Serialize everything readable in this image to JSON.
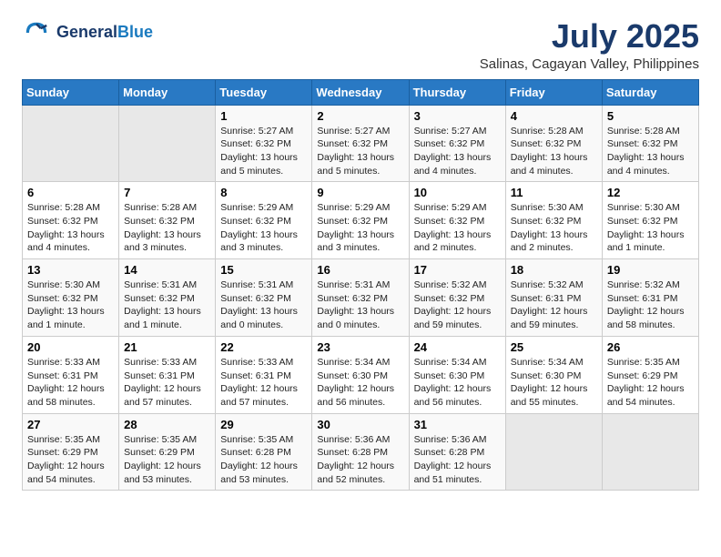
{
  "header": {
    "logo_line1": "General",
    "logo_line2": "Blue",
    "title": "July 2025",
    "subtitle": "Salinas, Cagayan Valley, Philippines"
  },
  "weekdays": [
    "Sunday",
    "Monday",
    "Tuesday",
    "Wednesday",
    "Thursday",
    "Friday",
    "Saturday"
  ],
  "weeks": [
    [
      {
        "day": "",
        "empty": true
      },
      {
        "day": "",
        "empty": true
      },
      {
        "day": "1",
        "sunrise": "5:27 AM",
        "sunset": "6:32 PM",
        "daylight": "13 hours and 5 minutes."
      },
      {
        "day": "2",
        "sunrise": "5:27 AM",
        "sunset": "6:32 PM",
        "daylight": "13 hours and 5 minutes."
      },
      {
        "day": "3",
        "sunrise": "5:27 AM",
        "sunset": "6:32 PM",
        "daylight": "13 hours and 4 minutes."
      },
      {
        "day": "4",
        "sunrise": "5:28 AM",
        "sunset": "6:32 PM",
        "daylight": "13 hours and 4 minutes."
      },
      {
        "day": "5",
        "sunrise": "5:28 AM",
        "sunset": "6:32 PM",
        "daylight": "13 hours and 4 minutes."
      }
    ],
    [
      {
        "day": "6",
        "sunrise": "5:28 AM",
        "sunset": "6:32 PM",
        "daylight": "13 hours and 4 minutes."
      },
      {
        "day": "7",
        "sunrise": "5:28 AM",
        "sunset": "6:32 PM",
        "daylight": "13 hours and 3 minutes."
      },
      {
        "day": "8",
        "sunrise": "5:29 AM",
        "sunset": "6:32 PM",
        "daylight": "13 hours and 3 minutes."
      },
      {
        "day": "9",
        "sunrise": "5:29 AM",
        "sunset": "6:32 PM",
        "daylight": "13 hours and 3 minutes."
      },
      {
        "day": "10",
        "sunrise": "5:29 AM",
        "sunset": "6:32 PM",
        "daylight": "13 hours and 2 minutes."
      },
      {
        "day": "11",
        "sunrise": "5:30 AM",
        "sunset": "6:32 PM",
        "daylight": "13 hours and 2 minutes."
      },
      {
        "day": "12",
        "sunrise": "5:30 AM",
        "sunset": "6:32 PM",
        "daylight": "13 hours and 1 minute."
      }
    ],
    [
      {
        "day": "13",
        "sunrise": "5:30 AM",
        "sunset": "6:32 PM",
        "daylight": "13 hours and 1 minute."
      },
      {
        "day": "14",
        "sunrise": "5:31 AM",
        "sunset": "6:32 PM",
        "daylight": "13 hours and 1 minute."
      },
      {
        "day": "15",
        "sunrise": "5:31 AM",
        "sunset": "6:32 PM",
        "daylight": "13 hours and 0 minutes."
      },
      {
        "day": "16",
        "sunrise": "5:31 AM",
        "sunset": "6:32 PM",
        "daylight": "13 hours and 0 minutes."
      },
      {
        "day": "17",
        "sunrise": "5:32 AM",
        "sunset": "6:32 PM",
        "daylight": "12 hours and 59 minutes."
      },
      {
        "day": "18",
        "sunrise": "5:32 AM",
        "sunset": "6:31 PM",
        "daylight": "12 hours and 59 minutes."
      },
      {
        "day": "19",
        "sunrise": "5:32 AM",
        "sunset": "6:31 PM",
        "daylight": "12 hours and 58 minutes."
      }
    ],
    [
      {
        "day": "20",
        "sunrise": "5:33 AM",
        "sunset": "6:31 PM",
        "daylight": "12 hours and 58 minutes."
      },
      {
        "day": "21",
        "sunrise": "5:33 AM",
        "sunset": "6:31 PM",
        "daylight": "12 hours and 57 minutes."
      },
      {
        "day": "22",
        "sunrise": "5:33 AM",
        "sunset": "6:31 PM",
        "daylight": "12 hours and 57 minutes."
      },
      {
        "day": "23",
        "sunrise": "5:34 AM",
        "sunset": "6:30 PM",
        "daylight": "12 hours and 56 minutes."
      },
      {
        "day": "24",
        "sunrise": "5:34 AM",
        "sunset": "6:30 PM",
        "daylight": "12 hours and 56 minutes."
      },
      {
        "day": "25",
        "sunrise": "5:34 AM",
        "sunset": "6:30 PM",
        "daylight": "12 hours and 55 minutes."
      },
      {
        "day": "26",
        "sunrise": "5:35 AM",
        "sunset": "6:29 PM",
        "daylight": "12 hours and 54 minutes."
      }
    ],
    [
      {
        "day": "27",
        "sunrise": "5:35 AM",
        "sunset": "6:29 PM",
        "daylight": "12 hours and 54 minutes."
      },
      {
        "day": "28",
        "sunrise": "5:35 AM",
        "sunset": "6:29 PM",
        "daylight": "12 hours and 53 minutes."
      },
      {
        "day": "29",
        "sunrise": "5:35 AM",
        "sunset": "6:28 PM",
        "daylight": "12 hours and 53 minutes."
      },
      {
        "day": "30",
        "sunrise": "5:36 AM",
        "sunset": "6:28 PM",
        "daylight": "12 hours and 52 minutes."
      },
      {
        "day": "31",
        "sunrise": "5:36 AM",
        "sunset": "6:28 PM",
        "daylight": "12 hours and 51 minutes."
      },
      {
        "day": "",
        "empty": true
      },
      {
        "day": "",
        "empty": true
      }
    ]
  ]
}
